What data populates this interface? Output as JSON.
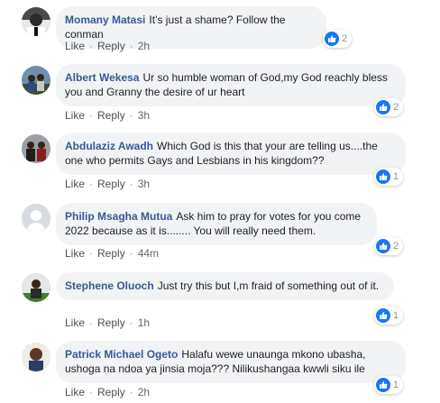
{
  "colors": {
    "author": "#385898",
    "bubble": "#f2f3f5",
    "like_badge": "#1877f2",
    "meta": "#606770"
  },
  "actions": {
    "like_label": "Like",
    "reply_label": "Reply",
    "separator": "·"
  },
  "comments": [
    {
      "author": "Momany Matasi",
      "text": "It’s just a shame? Follow the conman",
      "time": "2h",
      "reactions": "2",
      "reaction_icon": "like-icon"
    },
    {
      "author": "Albert Wekesa",
      "text": "Ur so humble woman of God,my God reachly bless you and Granny the desire of ur heart",
      "time": "3h",
      "reactions": "2",
      "reaction_icon": "like-icon"
    },
    {
      "author": "Abdulaziz Awadh",
      "text": "Which God is this that your are telling us....the one who permits Gays and Lesbians in his kingdom??",
      "time": "3h",
      "reactions": "1",
      "reaction_icon": "like-icon"
    },
    {
      "author": "Philip Msagha Mutua",
      "text": "Ask him to pray for votes for you come 2022 because as it is........ You will really need them.",
      "time": "44m",
      "reactions": "2",
      "reaction_icon": "like-icon"
    },
    {
      "author": "Stephene Oluoch",
      "text": "Just try this but I,m fraid of something out of it.",
      "time": "1h",
      "reactions": "1",
      "reaction_icon": "like-icon"
    },
    {
      "author": "Patrick Michael Ogeto",
      "text": "Halafu wewe unaunga mkono ubasha, ushoga na ndoa ya jinsia moja??? Nilikushangaa kwwli siku ile",
      "time": "2h",
      "reactions": "1",
      "reaction_icon": "like-icon"
    }
  ]
}
